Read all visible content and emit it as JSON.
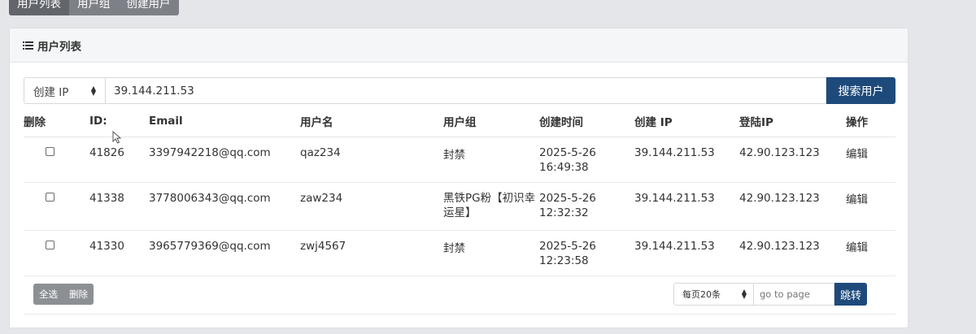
{
  "tabs": [
    {
      "label": "用户列表"
    },
    {
      "label": "用户组"
    },
    {
      "label": "创建用户"
    }
  ],
  "panel": {
    "title": "用户列表"
  },
  "search": {
    "field_label": "创建 IP",
    "value": "39.144.211.53",
    "button_label": "搜索用户"
  },
  "table": {
    "headers": {
      "delete": "删除",
      "id": "ID:",
      "email": "Email",
      "username": "用户名",
      "group": "用户组",
      "created": "创建时间",
      "create_ip": "创建 IP",
      "login_ip": "登陆IP",
      "action": "操作"
    },
    "rows": [
      {
        "id": "41826",
        "email": "3397942218@qq.com",
        "username": "qaz234",
        "group": "封禁",
        "date": "2025-5-26",
        "time": "16:49:38",
        "create_ip": "39.144.211.53",
        "login_ip": "42.90.123.123",
        "action": "编辑"
      },
      {
        "id": "41338",
        "email": "3778006343@qq.com",
        "username": "zaw234",
        "group": "黑铁PG粉【初识幸运星】",
        "date": "2025-5-26",
        "time": "12:32:32",
        "create_ip": "39.144.211.53",
        "login_ip": "42.90.123.123",
        "action": "编辑"
      },
      {
        "id": "41330",
        "email": "3965779369@qq.com",
        "username": "zwj4567",
        "group": "封禁",
        "date": "2025-5-26",
        "time": "12:23:58",
        "create_ip": "39.144.211.53",
        "login_ip": "42.90.123.123",
        "action": "编辑"
      }
    ]
  },
  "bulk": {
    "select_all": "全选",
    "delete": "删除"
  },
  "pager": {
    "per_page": "每页20条",
    "goto_placeholder": "go to page",
    "jump_label": "跳转"
  },
  "colors": {
    "primary": "#1e4a7b",
    "link": "#1f4e8a",
    "tab_bg": "#7d8187"
  }
}
